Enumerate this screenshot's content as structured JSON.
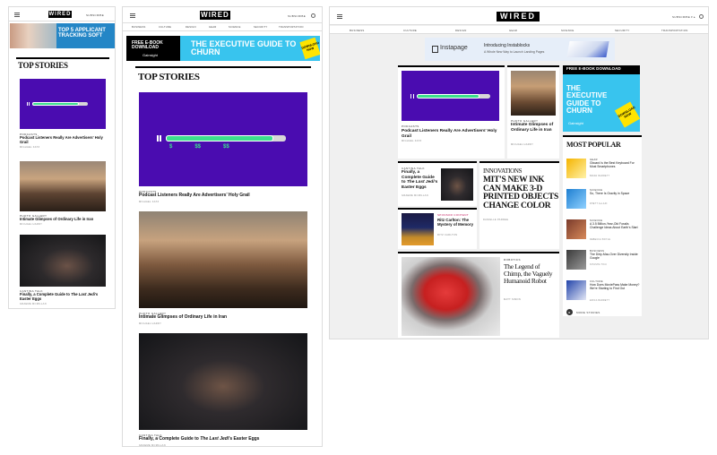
{
  "brand": {
    "logo": "WIRED",
    "subscribe": "SUBSCRIBE",
    "subscribe_desktop": "SUBSCRIBE ▾ ▸"
  },
  "nav": [
    "BUSINESS",
    "CULTURE",
    "DESIGN",
    "GEAR",
    "SCIENCE",
    "SECURITY",
    "TRANSPORTATION"
  ],
  "ads": {
    "mobile_ad": "TOP 5 APPLICANT TRACKING SOFT",
    "ebook_label": "FREE E-BOOK DOWNLOAD",
    "ebook_title": "THE EXECUTIVE GUIDE TO CHURN",
    "ebook_brand": "Gainsight",
    "ebook_cta": "DOWNLOAD NOW",
    "instapage_brand": "Instapage",
    "instapage_title": "Introducing Instablocks",
    "instapage_sub": "A Whole New Way to Launch Landing Pages"
  },
  "top_stories_title": "TOP STORIES",
  "stories": {
    "s1": {
      "kicker": "PODCASTS",
      "title": "Podcast Listeners Really Are Advertisers' Holy Grail",
      "byline": "MIGHAEL KATZ"
    },
    "s2": {
      "kicker": "PHOTO GALLERY",
      "title": "Intimate Glimpses of Ordinary Life in Iran",
      "byline": "MICHAEL HARDY"
    },
    "s3": {
      "kicker": "CANTINA TALK",
      "title_a": "Finally, a Complete Guide to ",
      "title_b": "The Last Jedi",
      "title_c": "'s Easter Eggs",
      "byline": "GRAEME MCMILLAN"
    },
    "s4": {
      "kicker": "INNOVATIONS",
      "title": "MIT'S NEW INK CAN MAKE 3-D PRINTED OBJECTS CHANGE COLOR",
      "byline": "DANIELLE PARDEE"
    },
    "s5": {
      "kicker": "SPONSOR CONTENT",
      "title": "Ritz Carlton: The Mystery of Memory",
      "byline": "RITZ CARLTON"
    },
    "s6": {
      "kicker": "ROBOTICS",
      "title": "The Legend of Chimp, the Vaguely Humanoid Robot",
      "byline": "MATT SIMON"
    }
  },
  "most_popular": {
    "title": "MOST POPULAR",
    "items": [
      {
        "kicker": "GEAR",
        "title": "Gboard Is the Best Keyboard For Most Smartphones",
        "byline": "BRIAN BARRETT"
      },
      {
        "kicker": "SCIENCE",
        "title": "So, There Is Gravity in Space",
        "byline": "RHETT ALLAIN"
      },
      {
        "kicker": "SCIENCE",
        "title": "A 3.5 Billion-Year-Old Fossils Challenge Ideas About Earth's Start",
        "byline": "REBECCA BOYLE"
      },
      {
        "kicker": "BUSINESS",
        "title": "The Dirty-Mac-Over Diversity Inside Google",
        "byline": "NITASHA TIKU"
      },
      {
        "kicker": "CULTURE",
        "title": "How Does MoviePass Make Money? We're Starting to Find Out",
        "byline": "ERICA BARRETT"
      }
    ],
    "more": "MORE STORIES"
  },
  "colors": {
    "purple": "#4a0cb0",
    "green": "#3be08d",
    "cyan": "#38c4ee",
    "black": "#000000"
  }
}
